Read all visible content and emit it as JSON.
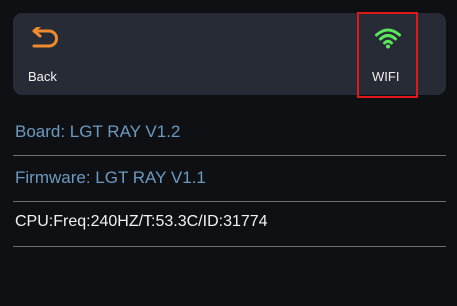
{
  "toolbar": {
    "back_label": "Back",
    "wifi_label": "WIFI"
  },
  "info": {
    "board": "Board: LGT RAY V1.2",
    "firmware": "Firmware: LGT RAY V1.1",
    "cpu": "CPU:Freq:240HZ/T:53.3C/ID:31774"
  },
  "colors": {
    "back_icon": "#f08a2e",
    "wifi_icon": "#5ce65c",
    "highlight_border": "#e0181a",
    "info_text": "#6c9ac1"
  },
  "icons": {
    "back": "back-arrow-icon",
    "wifi": "wifi-icon"
  }
}
